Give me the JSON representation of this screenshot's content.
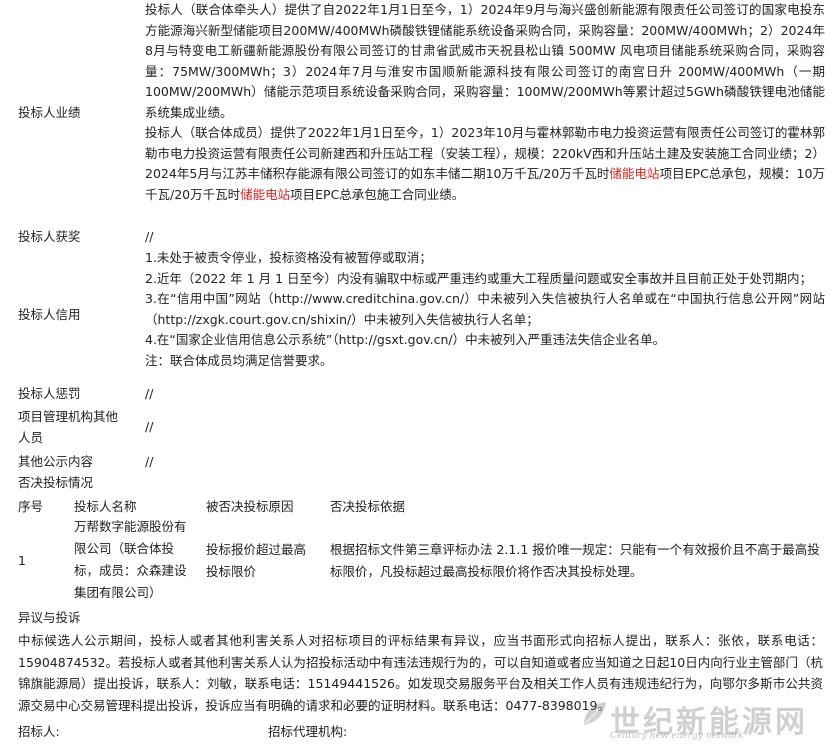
{
  "performance": {
    "label": "投标人业绩",
    "para1": "投标人（联合体牵头人）提供了自2022年1月1日至今，1）2024年9月与海兴盛创新能源有限责任公司签订的国家电投东方能源海兴新型储能项目200MW/400MWh磷酸铁锂储能系统设备采购合同，采购容量：200MW/400MWh；2）2024年8月与特变电工新疆新能源股份有限公司签订的甘肃省武威市天祝县松山镇 500MW 风电项目储能系统采购合同，采购容量：75MW/300MWh；3）2024年7月与淮安市国顺新能源科技有限公司签订的南宫日升 200MW/400MWh（一期100MW/200MWh）储能示范项目系统设备采购合同，采购容量：100MW/200MWh等累计超过5GWh磷酸铁锂电池储能系统集成业绩。",
    "para2_part1": "投标人（联合体成员）提供了2022年1月1日至今，1）2023年10月与霍林郭勒市电力投资运营有限责任公司签订的霍林郭勒市电力投资运营有限责任公司新建西和升压站工程（安装工程），规模：220kV西和升压站土建及安装施工合同业绩；2）2024年5月与江苏丰储积存能源有限公司签订的如东丰储二期10万千瓦/20万千瓦时",
    "para2_hl1": "储能电站",
    "para2_part2": "项目EPC总承包，规模：10万千瓦/20万千瓦时",
    "para2_hl2": "储能电站",
    "para2_part3": "项目EPC总承包施工合同业绩。"
  },
  "awards": {
    "label": "投标人获奖",
    "value": "//"
  },
  "credit": {
    "label": "投标人信用",
    "line1": "1.未处于被责令停业，投标资格没有被暂停或取消；",
    "line2": "2.近年（2022 年 1 月 1 日至今）内没有骗取中标或严重违约或重大工程质量问题或安全事故并且目前正处于处罚期内；",
    "line3": "3.在“信用中国”网站（http://www.creditchina.gov.cn/）中未被列入失信被执行人名单或在“中国执行信息公开网”网站（http://zxgk.court.gov.cn/shixin/）中未被列入失信被执行人名单；",
    "line4": "4.在“国家企业信用信息公示系统”（http://gsxt.gov.cn/）中未被列入严重违法失信企业名单。",
    "note": "注：联合体成员均满足信誉要求。"
  },
  "penalty": {
    "label": "投标人惩罚",
    "value": "//"
  },
  "pm_other": {
    "label": "项目管理机构其他人员",
    "value": "//"
  },
  "other_public": {
    "label": "其他公示内容",
    "value": "//"
  },
  "rejection": {
    "title": "否决投标情况",
    "headers": [
      "序号",
      "投标人名称",
      "被否决投标原因",
      "否决投标依据"
    ],
    "rows": [
      {
        "seq": "1",
        "name": "万帮数字能源股份有限公司（联合体投标，成员：众森建设集团有限公司）",
        "reason": "投标报价超过最高投标限价",
        "basis": "根据招标文件第三章评标办法 2.1.1 报价唯一规定：只能有一个有效报价且不高于最高投标限价，凡投标超过最高投标限价将作否决其投标处理。"
      }
    ]
  },
  "objection": {
    "title": "异议与投诉",
    "text": "中标候选人公示期间，投标人或者其他利害关系人对招标项目的评标结果有异议，应当书面形式向招标人提出，联系人：张依，联系电话：15904874532。若投标人或者其他利害关系人认为招投标活动中有违法违规行为的，可以自知道或者应当知道之日起10日内向行业主管部门（杭锦旗能源局）提出投诉，联系人：刘敏，联系电话：15149441526。如发现交易服务平台及相关工作人员有违规违纪行为，向鄂尔多斯市公共资源交易中心交易管理科提出投诉，投诉应当有明确的请求和必要的证明材料。联系电话：0477-8398019。"
  },
  "footer": {
    "tenderer_label": "招标人:",
    "agency_label": "招标代理机构:"
  },
  "watermark": {
    "text": "世纪新能源网",
    "sub": "Century new energy network",
    "color": "#7a7a7a"
  }
}
